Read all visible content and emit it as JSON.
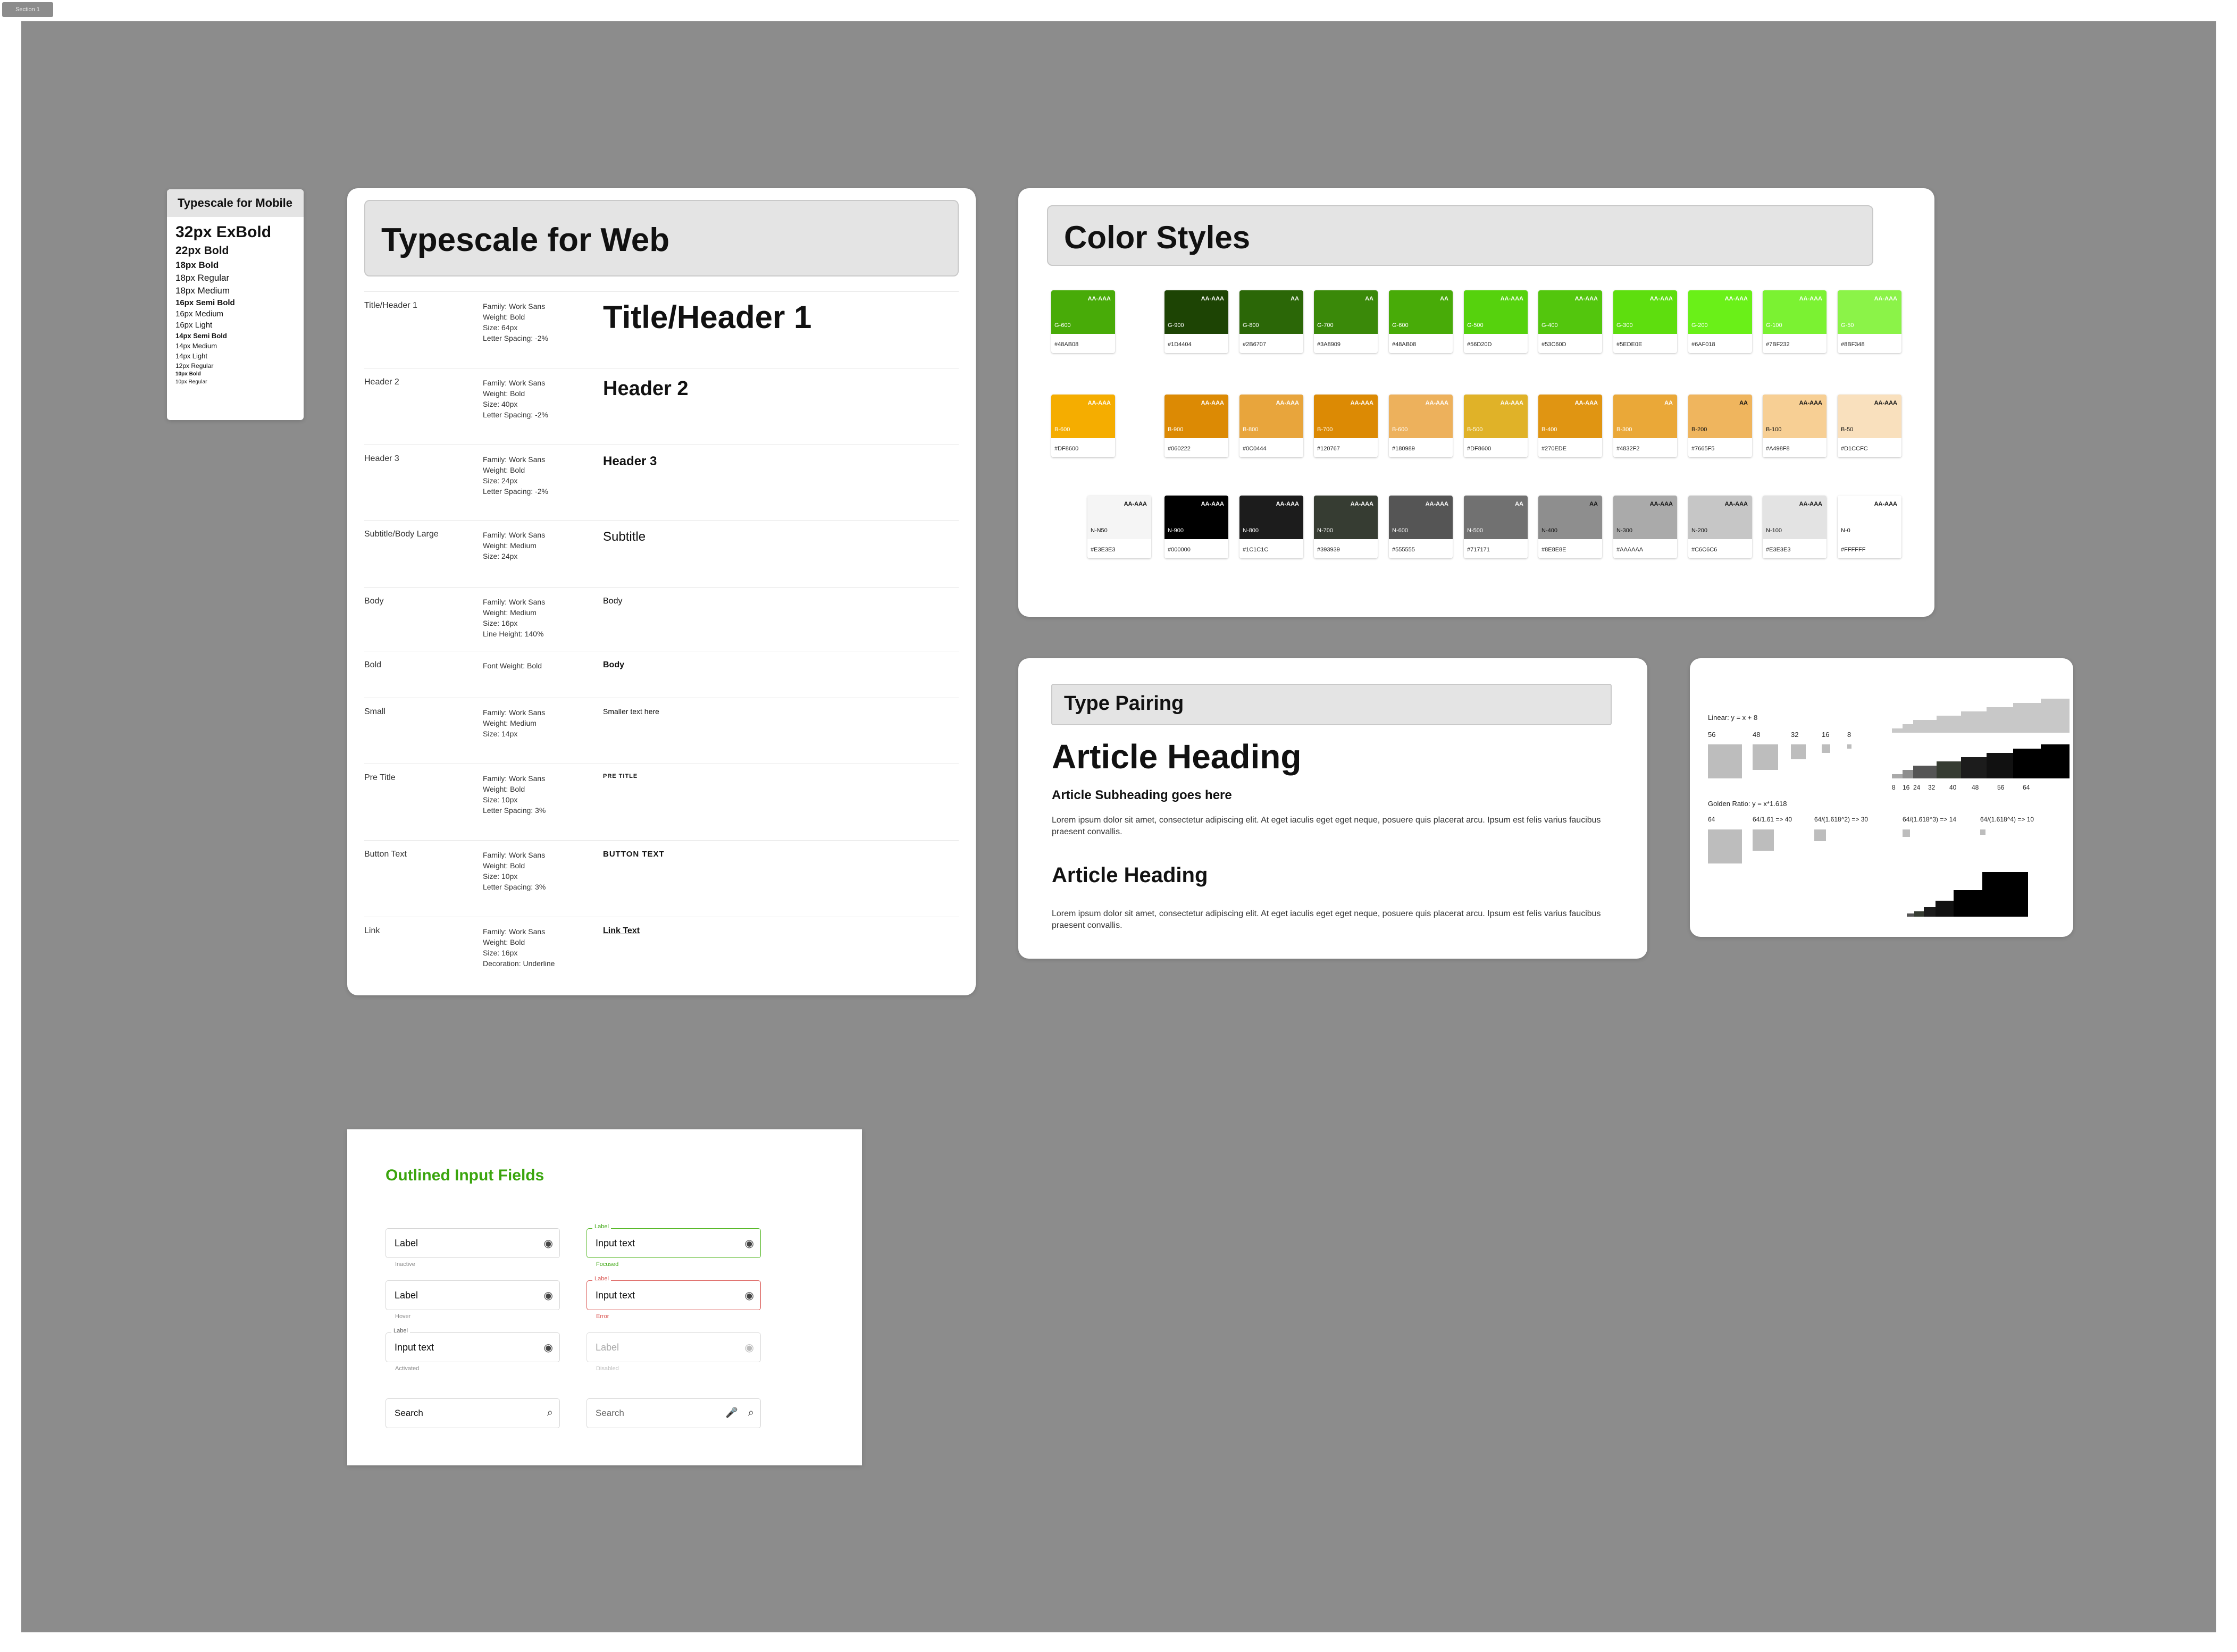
{
  "section_label": "Section 1",
  "mobile": {
    "title": "Typescale for Mobile",
    "rows": [
      {
        "text": "32px ExBold",
        "size": 30,
        "weight": "900"
      },
      {
        "text": "22px Bold",
        "size": 21,
        "weight": "bold"
      },
      {
        "text": "18px Bold",
        "size": 17,
        "weight": "bold"
      },
      {
        "text": "18px Regular",
        "size": 17,
        "weight": "normal"
      },
      {
        "text": "18px Medium",
        "size": 17,
        "weight": "500"
      },
      {
        "text": "16px Semi Bold",
        "size": 15,
        "weight": "bold"
      },
      {
        "text": "16px Medium",
        "size": 15,
        "weight": "500"
      },
      {
        "text": "16px Light",
        "size": 15,
        "weight": "300"
      },
      {
        "text": "14px Semi Bold",
        "size": 13,
        "weight": "bold"
      },
      {
        "text": "14px Medium",
        "size": 13,
        "weight": "500"
      },
      {
        "text": "14px Light",
        "size": 13,
        "weight": "300"
      },
      {
        "text": "12px Regular",
        "size": 12,
        "weight": "normal"
      },
      {
        "text": "10px Bold",
        "size": 10,
        "weight": "bold"
      },
      {
        "text": "10px Regular",
        "size": 10,
        "weight": "normal"
      }
    ]
  },
  "web": {
    "title": "Typescale for Web",
    "rows": [
      {
        "label": "Title/Header 1",
        "spec": [
          "Family: Work Sans",
          "Weight: Bold",
          "Size: 64px",
          "Letter Spacing: -2%"
        ],
        "sample": "Title/Header 1",
        "size": 60,
        "weight": "bold",
        "upper": false,
        "underline": false
      },
      {
        "label": "Header 2",
        "spec": [
          "Family: Work Sans",
          "Weight: Bold",
          "Size: 40px",
          "Letter Spacing: -2%"
        ],
        "sample": "Header 2",
        "size": 38,
        "weight": "bold",
        "upper": false,
        "underline": false
      },
      {
        "label": "Header 3",
        "spec": [
          "Family: Work Sans",
          "Weight: Bold",
          "Size: 24px",
          "Letter Spacing: -2%"
        ],
        "sample": "Header 3",
        "size": 24,
        "weight": "bold",
        "upper": false,
        "underline": false
      },
      {
        "label": "Subtitle/Body Large",
        "spec": [
          "Family: Work Sans",
          "Weight: Medium",
          "Size: 24px"
        ],
        "sample": "Subtitle",
        "size": 24,
        "weight": "500",
        "upper": false,
        "underline": false
      },
      {
        "label": "Body",
        "spec": [
          "Family: Work Sans",
          "Weight: Medium",
          "Size: 16px",
          "Line Height: 140%"
        ],
        "sample": "Body",
        "size": 16,
        "weight": "500",
        "upper": false,
        "underline": false
      },
      {
        "label": "Bold",
        "spec": [
          "Font Weight: Bold"
        ],
        "sample": "Body",
        "size": 16,
        "weight": "bold",
        "upper": false,
        "underline": false
      },
      {
        "label": "Small",
        "spec": [
          "Family: Work Sans",
          "Weight: Medium",
          "Size: 14px"
        ],
        "sample": "Smaller text here",
        "size": 14,
        "weight": "500",
        "upper": false,
        "underline": false
      },
      {
        "label": "Pre Title",
        "spec": [
          "Family: Work Sans",
          "Weight: Bold",
          "Size: 10px",
          "Letter Spacing: 3%"
        ],
        "sample": "PRE TITLE",
        "size": 11,
        "weight": "bold",
        "upper": true,
        "underline": false
      },
      {
        "label": "Button Text",
        "spec": [
          "Family: Work Sans",
          "Weight: Bold",
          "Size: 10px",
          "Letter Spacing: 3%"
        ],
        "sample": "BUTTON TEXT",
        "size": 15,
        "weight": "bold",
        "upper": true,
        "underline": false
      },
      {
        "label": "Link",
        "spec": [
          "Family: Work Sans",
          "Weight: Bold",
          "Size: 16px",
          "Decoration: Underline"
        ],
        "sample": "Link Text",
        "size": 16,
        "weight": "bold",
        "upper": false,
        "underline": true
      }
    ]
  },
  "colors": {
    "title": "Color Styles",
    "green": [
      {
        "name": "G-600",
        "hex": "#48AB08",
        "level": "AA-AAA",
        "color": "#48ab08",
        "text": "#ffffff"
      },
      {
        "name": "G-900",
        "hex": "#1D4404",
        "level": "AA-AAA",
        "color": "#1d4404",
        "text": "#ffffff"
      },
      {
        "name": "G-800",
        "hex": "#2B6707",
        "level": "AA",
        "color": "#2b6707",
        "text": "#ffffff"
      },
      {
        "name": "G-700",
        "hex": "#3A8909",
        "level": "AA",
        "color": "#3a8909",
        "text": "#ffffff"
      },
      {
        "name": "G-600",
        "hex": "#48AB08",
        "level": "AA",
        "color": "#48ab08",
        "text": "#ffffff"
      },
      {
        "name": "G-500",
        "hex": "#56D20D",
        "level": "AA-AAA",
        "color": "#56d20d",
        "text": "#ffffff"
      },
      {
        "name": "G-400",
        "hex": "#53C60D",
        "level": "AA-AAA",
        "color": "#53c60d",
        "text": "#ffffff"
      },
      {
        "name": "G-300",
        "hex": "#5EDE0E",
        "level": "AA-AAA",
        "color": "#5ede0e",
        "text": "#ffffff"
      },
      {
        "name": "G-200",
        "hex": "#6AF018",
        "level": "AA-AAA",
        "color": "#6af018",
        "text": "#ffffff"
      },
      {
        "name": "G-100",
        "hex": "#7BF232",
        "level": "AA-AAA",
        "color": "#7bf232",
        "text": "#ffffff"
      },
      {
        "name": "G-50",
        "hex": "#8BF348",
        "level": "AA-AAA",
        "color": "#8bf348",
        "text": "#ffffff"
      }
    ],
    "orange": [
      {
        "name": "B-600",
        "hex": "#DF8600",
        "level": "AA-AAA",
        "color": "#f5ad00",
        "text": "#ffffff"
      },
      {
        "name": "B-900",
        "hex": "#060222",
        "level": "AA-AAA",
        "color": "#dc8a04",
        "text": "#ffffff"
      },
      {
        "name": "B-800",
        "hex": "#0C0444",
        "level": "AA-AAA",
        "color": "#e8a53c",
        "text": "#ffffff"
      },
      {
        "name": "B-700",
        "hex": "#120767",
        "level": "AA-AAA",
        "color": "#dc8a04",
        "text": "#ffffff"
      },
      {
        "name": "B-600",
        "hex": "#180989",
        "level": "AA-AAA",
        "color": "#edb15c",
        "text": "#ffffff"
      },
      {
        "name": "B-500",
        "hex": "#DF8600",
        "level": "AA-AAA",
        "color": "#e0b228",
        "text": "#ffffff"
      },
      {
        "name": "B-400",
        "hex": "#270EDE",
        "level": "AA-AAA",
        "color": "#e09512",
        "text": "#ffffff"
      },
      {
        "name": "B-300",
        "hex": "#4832F2",
        "level": "AA",
        "color": "#eaa838",
        "text": "#ffffff"
      },
      {
        "name": "B-200",
        "hex": "#7665F5",
        "level": "AA",
        "color": "#efb55e",
        "text": "#111111"
      },
      {
        "name": "B-100",
        "hex": "#A498F8",
        "level": "AA-AAA",
        "color": "#f7cf94",
        "text": "#111111"
      },
      {
        "name": "B-50",
        "hex": "#D1CCFC",
        "level": "AA-AAA",
        "color": "#f9e0bd",
        "text": "#111111"
      }
    ],
    "neutral": [
      {
        "name": "N-N50",
        "hex": "#E3E3E3",
        "level": "AA-AAA",
        "color": "#f5f5f5",
        "text": "#111111"
      },
      {
        "name": "N-900",
        "hex": "#000000",
        "level": "AA-AAA",
        "color": "#000000",
        "text": "#ffffff"
      },
      {
        "name": "N-800",
        "hex": "#1C1C1C",
        "level": "AA-AAA",
        "color": "#1c1c1c",
        "text": "#ffffff"
      },
      {
        "name": "N-700",
        "hex": "#393939",
        "level": "AA-AAA",
        "color": "#363c32",
        "text": "#ffffff"
      },
      {
        "name": "N-600",
        "hex": "#555555",
        "level": "AA-AAA",
        "color": "#555555",
        "text": "#ffffff"
      },
      {
        "name": "N-500",
        "hex": "#717171",
        "level": "AA",
        "color": "#717171",
        "text": "#ffffff"
      },
      {
        "name": "N-400",
        "hex": "#8E8E8E",
        "level": "AA",
        "color": "#8e8e8e",
        "text": "#111111"
      },
      {
        "name": "N-300",
        "hex": "#AAAAAA",
        "level": "AA-AAA",
        "color": "#aaaaaa",
        "text": "#111111"
      },
      {
        "name": "N-200",
        "hex": "#C6C6C6",
        "level": "AA-AAA",
        "color": "#c6c6c6",
        "text": "#111111"
      },
      {
        "name": "N-100",
        "hex": "#E3E3E3",
        "level": "AA-AAA",
        "color": "#e3e3e3",
        "text": "#111111"
      },
      {
        "name": "N-0",
        "hex": "#FFFFFF",
        "level": "AA-AAA",
        "color": "#ffffff",
        "text": "#111111"
      }
    ]
  },
  "pairing": {
    "title": "Type Pairing",
    "heading1": "Article Heading",
    "subheading": "Article Subheading goes here",
    "body1": "Lorem ipsum dolor sit amet, consectetur adipiscing elit. At eget iaculis eget eget neque, posuere quis placerat arcu. Ipsum est felis varius faucibus praesent convallis.",
    "heading2": "Article Heading",
    "body2": "Lorem ipsum dolor sit amet, consectetur adipiscing elit. At eget iaculis eget eget neque, posuere quis placerat arcu. Ipsum est felis varius faucibus praesent convallis."
  },
  "scale": {
    "linear_label": "Linear: y = x + 8",
    "linear_values": [
      "56",
      "48",
      "32",
      "16",
      "8"
    ],
    "linear_axis": [
      "8",
      "16",
      "24",
      "32",
      "40",
      "48",
      "56",
      "64"
    ],
    "golden_label": "Golden Ratio: y = x*1.618",
    "golden_values": [
      "64",
      "64/1.61 => 40",
      "64/(1.618^2) => 30",
      "64/(1.618^3) => 14",
      "64/(1.618^4) => 10"
    ]
  },
  "inputs": {
    "title": "Outlined Input Fields",
    "title_color": "#3aa50d",
    "fields": [
      {
        "text": "Label",
        "hint": "Inactive",
        "label": "",
        "state": "inactive"
      },
      {
        "text": "Input text",
        "hint": "Focused",
        "label": "Label",
        "state": "focused"
      },
      {
        "text": "Label",
        "hint": "Hover",
        "label": "",
        "state": "hover"
      },
      {
        "text": "Input text",
        "hint": "Error",
        "label": "Label",
        "state": "error"
      },
      {
        "text": "Input text",
        "hint": "Activated",
        "label": "Label",
        "state": "activated"
      },
      {
        "text": "Label",
        "hint": "Disabled",
        "label": "",
        "state": "disabled"
      }
    ],
    "search1": "Search",
    "search2": "Search"
  }
}
